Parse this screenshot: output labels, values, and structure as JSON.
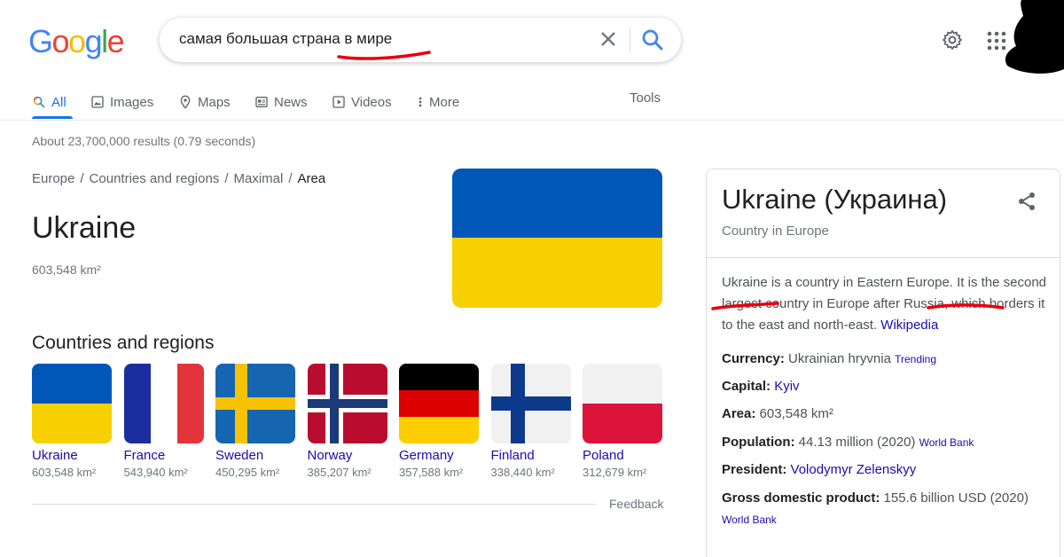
{
  "logo": {
    "letters": [
      "G",
      "o",
      "o",
      "g",
      "l",
      "e"
    ]
  },
  "search": {
    "query": "самая большая страна в мире"
  },
  "tabs": [
    {
      "label": "All",
      "icon": "search-icon"
    },
    {
      "label": "Images",
      "icon": "image-icon"
    },
    {
      "label": "Maps",
      "icon": "map-pin-icon"
    },
    {
      "label": "News",
      "icon": "news-icon"
    },
    {
      "label": "Videos",
      "icon": "play-icon"
    },
    {
      "label": "More",
      "icon": "more-vert-icon"
    }
  ],
  "tools_label": "Tools",
  "stats": "About 23,700,000 results (0.79 seconds)",
  "breadcrumb": [
    "Europe",
    "Countries and regions",
    "Maximal",
    "Area"
  ],
  "breadcrumb_sep": "/",
  "answer": {
    "title": "Ukraine",
    "value": "603,548 km²"
  },
  "related": {
    "title": "Countries and regions",
    "items": [
      {
        "name": "Ukraine",
        "area": "603,548 km²"
      },
      {
        "name": "France",
        "area": "543,940 km²"
      },
      {
        "name": "Sweden",
        "area": "450,295 km²"
      },
      {
        "name": "Norway",
        "area": "385,207 km²"
      },
      {
        "name": "Germany",
        "area": "357,588 km²"
      },
      {
        "name": "Finland",
        "area": "338,440 km²"
      },
      {
        "name": "Poland",
        "area": "312,679 km²"
      }
    ]
  },
  "feedback": "Feedback",
  "panel": {
    "title": "Ukraine (Украина)",
    "subtitle": "Country in Europe",
    "description": "Ukraine is a country in Eastern Europe. It is the second largest country in Europe after Russia, which borders it to the east and north-east.",
    "description_link": "Wikipedia",
    "facts": [
      {
        "label": "Currency:",
        "value": "Ukrainian hryvnia",
        "value_is_link": false,
        "note": "Trending"
      },
      {
        "label": "Capital:",
        "value": "Kyiv",
        "value_is_link": true,
        "note": ""
      },
      {
        "label": "Area:",
        "value": "603,548 km²",
        "value_is_link": false,
        "note": ""
      },
      {
        "label": "Population:",
        "value": "44.13 million (2020)",
        "value_is_link": false,
        "note": "World Bank"
      },
      {
        "label": "President:",
        "value": "Volodymyr Zelenskyy",
        "value_is_link": true,
        "note": ""
      },
      {
        "label": "Gross domestic product:",
        "value": "155.6 billion USD (2020)",
        "value_is_link": false,
        "note": "World Bank"
      }
    ]
  },
  "colors": {
    "accent": "#1a73e8",
    "link": "#1a0dab",
    "annotation": "#e8000b",
    "ua_blue": "#0057b7",
    "ua_yellow": "#f6d000"
  }
}
